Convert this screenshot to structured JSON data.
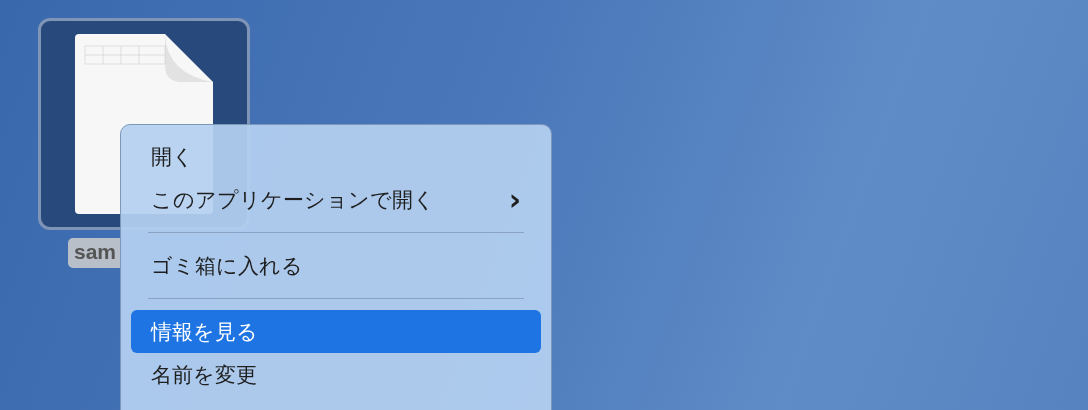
{
  "desktop_icon": {
    "label": "sam",
    "selected": true
  },
  "context_menu": {
    "items": [
      {
        "kind": "item",
        "label": "開く",
        "selected": false,
        "submenu": false
      },
      {
        "kind": "item",
        "label": "このアプリケーションで開く",
        "selected": false,
        "submenu": true,
        "arrow": "›"
      },
      {
        "kind": "separator"
      },
      {
        "kind": "item",
        "label": "ゴミ箱に入れる",
        "selected": false,
        "submenu": false
      },
      {
        "kind": "separator"
      },
      {
        "kind": "item",
        "label": "情報を見る",
        "selected": true,
        "submenu": false
      },
      {
        "kind": "item",
        "label": "名前を変更",
        "selected": false,
        "submenu": false
      }
    ]
  }
}
